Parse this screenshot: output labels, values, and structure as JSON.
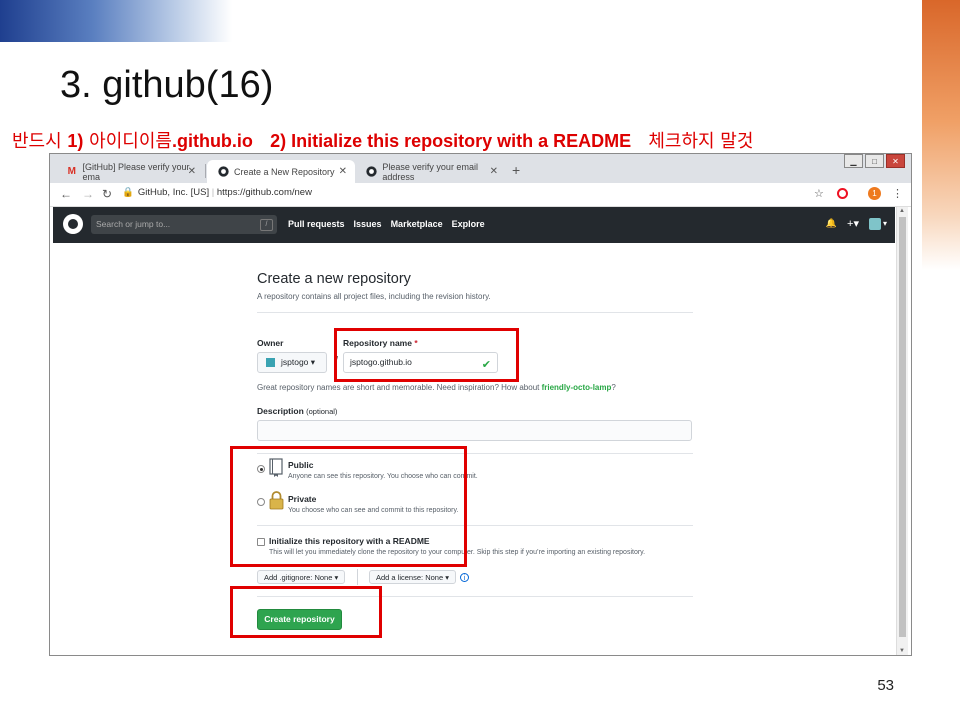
{
  "slide": {
    "title": "3. github(16)",
    "instruction_prefix": "반드시 ",
    "instruction_step1_num": "1)",
    "instruction_step1_korean": " 아이디이름",
    "instruction_step1_domain": ".github.io",
    "instruction_step2": "2) Initialize  this repository with a README",
    "instruction_suffix": "체크하지 말것",
    "page_number": "53",
    "highlight_color": "#e00000"
  },
  "browser": {
    "tabs": [
      {
        "label": "[GitHub] Please verify your ema",
        "icon": "gmail-icon"
      },
      {
        "label": "Create a New Repository",
        "icon": "github-icon"
      },
      {
        "label": "Please verify your email address",
        "icon": "github-icon"
      }
    ],
    "new_tab": "+",
    "url_org": "GitHub, Inc. [US]",
    "url_sep": "|",
    "url": "https://github.com/new",
    "avatar_initial": "1"
  },
  "github_header": {
    "search_placeholder": "Search or jump to...",
    "search_key": "/",
    "nav": [
      "Pull requests",
      "Issues",
      "Marketplace",
      "Explore"
    ],
    "bell": "🔔",
    "plus": "+▾",
    "avatar_caret": "▾"
  },
  "form": {
    "heading": "Create a new repository",
    "subheading": "A repository contains all project files, including the revision history.",
    "owner_label": "Owner",
    "owner_value": "jsptogo ▾",
    "repo_label": "Repository name",
    "required_mark": "*",
    "slash": "/",
    "repo_value": "jsptogo.github.io",
    "hint_prefix": "Great repository names are short and memorable. Need inspiration? How about ",
    "hint_suggestion": "friendly-octo-lamp",
    "hint_suffix": "?",
    "description_label": "Description",
    "description_optional": "(optional)",
    "public_title": "Public",
    "public_desc": "Anyone can see this repository. You choose who can commit.",
    "private_title": "Private",
    "private_desc": "You choose who can see and commit to this repository.",
    "readme_title": "Initialize this repository with a README",
    "readme_desc": "This will let you immediately clone the repository to your computer. Skip this step if you’re importing an existing repository.",
    "gitignore_label": "Add .gitignore: None ▾",
    "license_label": "Add a license: None ▾",
    "info": "i",
    "create_button": "Create repository",
    "visibility_selected": "Public",
    "readme_checked": false
  }
}
